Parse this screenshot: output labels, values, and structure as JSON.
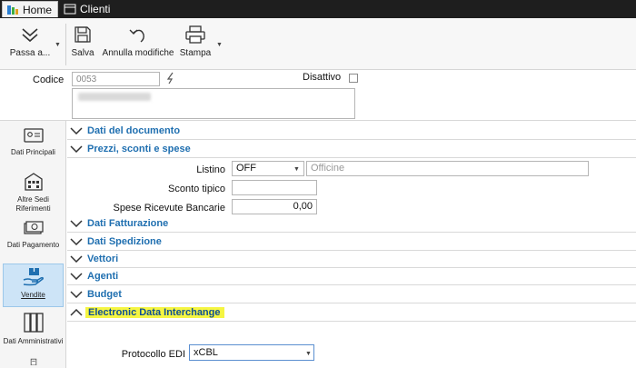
{
  "tabs": [
    {
      "label": "Home",
      "icon": "home-app-icon"
    },
    {
      "label": "Clienti",
      "icon": "clients-window-icon"
    }
  ],
  "ribbon": {
    "passa": "Passa a...",
    "salva": "Salva",
    "annulla": "Annulla modifiche",
    "stampa": "Stampa"
  },
  "header": {
    "codice_label": "Codice",
    "codice_value": "0053",
    "descrizione_value": "",
    "disattivo_label": "Disattivo"
  },
  "nav": [
    {
      "label": "Dati Principali",
      "icon": "id-card-icon",
      "active": false
    },
    {
      "label": "Altre Sedi Riferimenti",
      "icon": "building-icon",
      "active": false
    },
    {
      "label": "Dati Pagamento",
      "icon": "money-icon",
      "active": false
    },
    {
      "label": "Vendite",
      "icon": "box-hand-icon",
      "active": true
    },
    {
      "label": "Dati Amministrativi",
      "icon": "binders-icon",
      "active": false
    }
  ],
  "sections": {
    "dati_documento": "Dati del documento",
    "prezzi": "Prezzi, sconti e spese",
    "fatturazione": "Dati Fatturazione",
    "spedizione": "Dati Spedizione",
    "vettori": "Vettori",
    "agenti": "Agenti",
    "budget": "Budget",
    "edi": "Electronic Data Interchange"
  },
  "prezzi_fields": {
    "listino_label": "Listino",
    "listino_value": "OFF",
    "listino_desc": "Officine",
    "sconto_label": "Sconto tipico",
    "sconto_value": "",
    "spese_label": "Spese Ricevute Bancarie",
    "spese_value": "0,00"
  },
  "edi_fields": {
    "protocollo_label": "Protocollo EDI",
    "protocollo_value": "xCBL"
  },
  "colors": {
    "accent_blue": "#1f6fb0",
    "highlight": "#f5f542",
    "nav_active": "#cde4f7"
  }
}
